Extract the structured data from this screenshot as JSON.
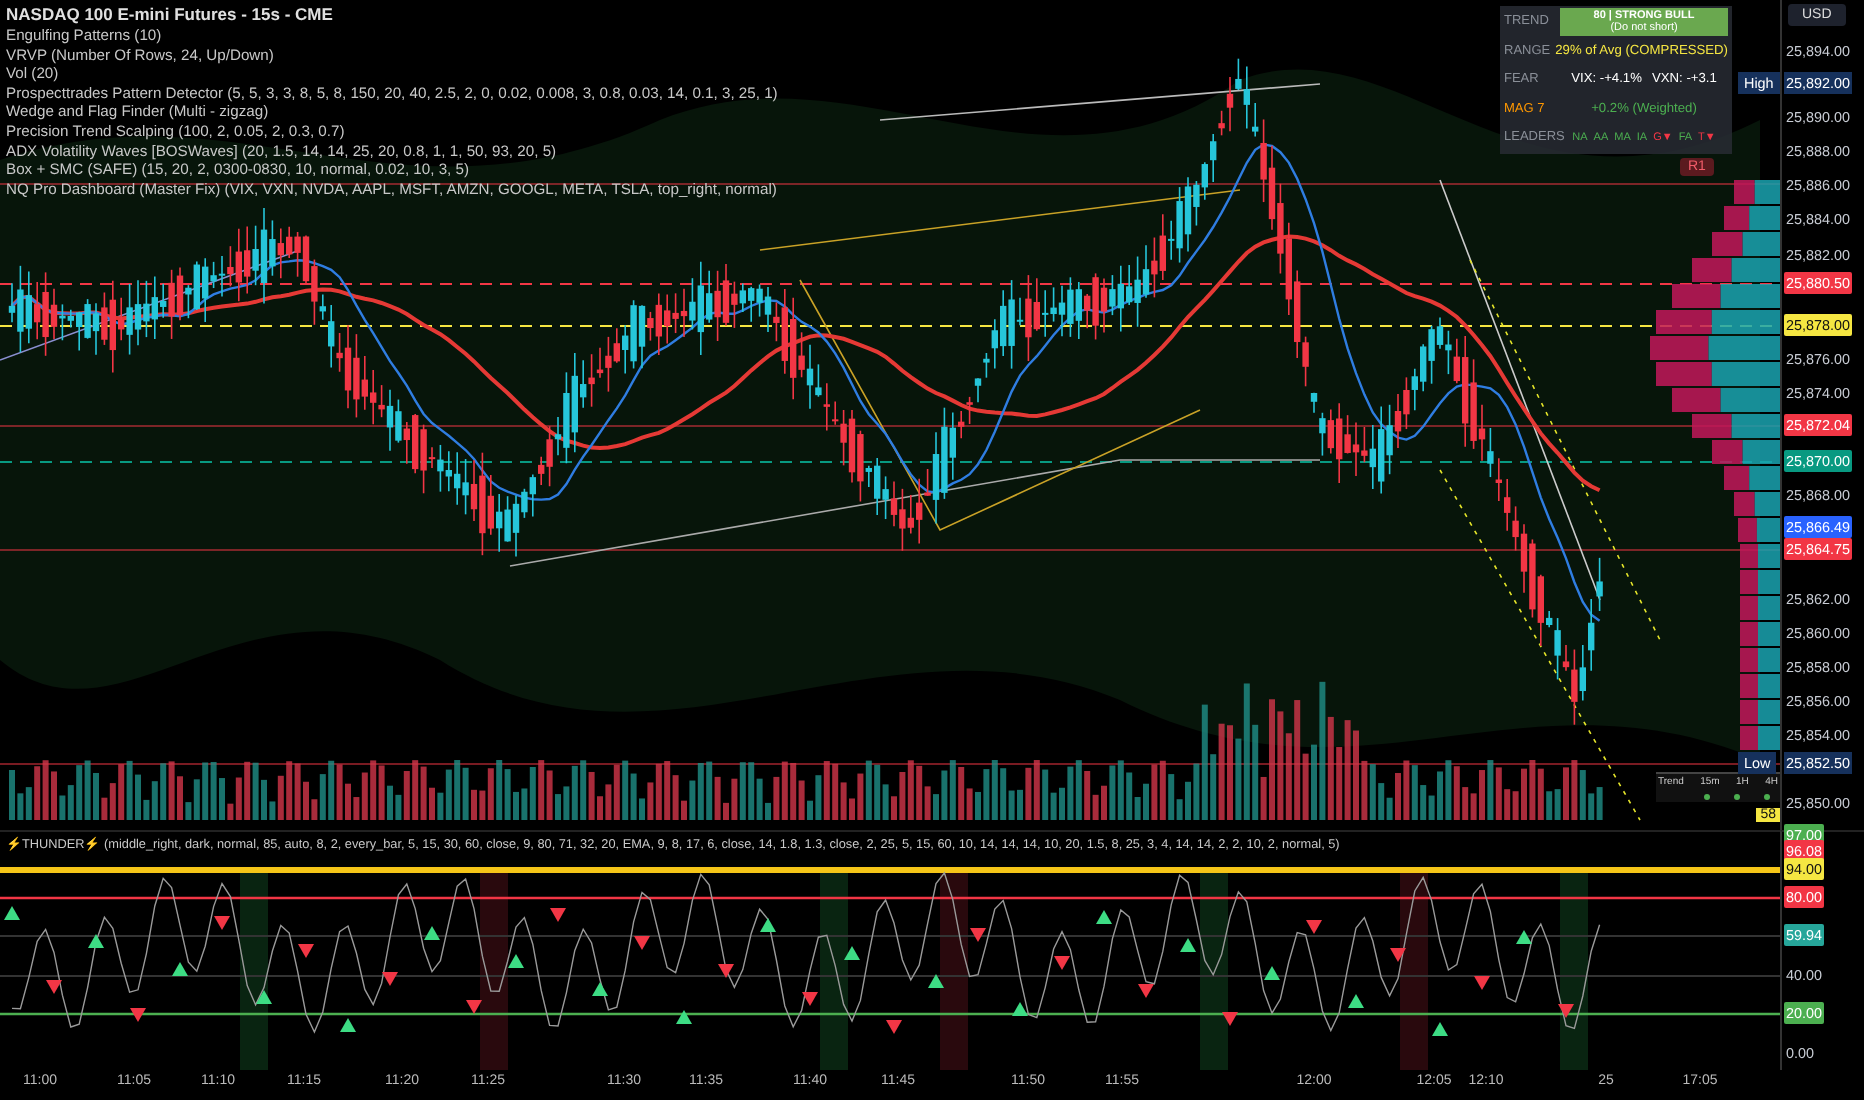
{
  "chart": {
    "title": "NASDAQ 100 E-mini Futures - 15s - CME",
    "indicators": [
      "Engulfing Patterns (10)",
      "VRVP (Number Of Rows, 24, Up/Down)",
      "Vol (20)",
      "Prospecttrades Pattern Detector (5, 5, 3, 3, 8, 5, 8, 150, 20, 40, 2.5, 2, 0, 0.02, 0.008, 3, 0.8, 0.03, 14, 0.1, 3, 25, 1)",
      "Wedge and Flag Finder (Multi - zigzag)",
      "Precision Trend Scalping (100, 2, 0.05, 2, 0.3, 0.7)",
      "ADX Volatility Waves [BOSWaves] (20, 1.5, 14, 14, 25, 20, 0.8, 1, 1, 50, 93, 20, 5)",
      "Box + SMC (SAFE) (15, 20, 2, 0300-0830, 10, normal, 0.02, 10, 3, 5)",
      "NQ Pro Dashboard (Master Fix) (VIX, VXN, NVDA, AAPL, MSFT, AMZN, GOOGL, META, TSLA, top_right, normal)"
    ],
    "r1_label": "R1"
  },
  "dashboard": {
    "rows": [
      {
        "label": "TREND",
        "highlighted": false,
        "kind": "banner",
        "value": "80 | STRONG BULL",
        "note": "(Do not short)"
      },
      {
        "label": "RANGE",
        "highlighted": false,
        "kind": "text",
        "value": "29% of Avg (COMPRESSED)",
        "color": "#f5e642"
      },
      {
        "label": "FEAR",
        "highlighted": false,
        "kind": "pair",
        "values": [
          "VIX: -+4.1%",
          "VXN: -+3.1"
        ]
      },
      {
        "label": "MAG 7",
        "highlighted": true,
        "kind": "text",
        "value": "+0.2% (Weighted)",
        "color": "#4caf50"
      },
      {
        "label": "LEADERS",
        "highlighted": false,
        "kind": "chips",
        "chips": [
          {
            "text": "NA",
            "color": "#4caf50"
          },
          {
            "text": "AA",
            "color": "#4caf50"
          },
          {
            "text": "MA",
            "color": "#4caf50"
          },
          {
            "text": "IA",
            "color": "#4caf50"
          },
          {
            "text": "G▼",
            "color": "#f23645"
          },
          {
            "text": "FA",
            "color": "#4caf50"
          },
          {
            "text": "T▼",
            "color": "#f23645"
          }
        ]
      }
    ]
  },
  "currency_button": "USD",
  "price_axis": [
    {
      "text": "25,894.00",
      "kind": "plain"
    },
    {
      "text": "25,892.00",
      "kind": "marker",
      "marker": "High"
    },
    {
      "text": "25,890.00",
      "kind": "plain"
    },
    {
      "text": "25,888.00",
      "kind": "plain"
    },
    {
      "text": "25,886.00",
      "kind": "plain"
    },
    {
      "text": "25,884.00",
      "kind": "plain"
    },
    {
      "text": "25,882.00",
      "kind": "plain"
    },
    {
      "text": "25,880.50",
      "kind": "tag",
      "color": "#f23645"
    },
    {
      "text": "25,878.00",
      "kind": "tag",
      "color": "#f5e642"
    },
    {
      "text": "25,876.00",
      "kind": "plain"
    },
    {
      "text": "25,874.00",
      "kind": "plain"
    },
    {
      "text": "25,872.04",
      "kind": "tag",
      "color": "#f23645"
    },
    {
      "text": "25,870.00",
      "kind": "tag",
      "color": "#089981"
    },
    {
      "text": "25,868.00",
      "kind": "plain"
    },
    {
      "text": "25,866.49",
      "kind": "tag",
      "color": "#2962ff"
    },
    {
      "text": "25,864.75",
      "kind": "tag",
      "color": "#f23645"
    },
    {
      "text": "25,862.00",
      "kind": "plain"
    },
    {
      "text": "25,860.00",
      "kind": "plain"
    },
    {
      "text": "25,858.00",
      "kind": "plain"
    },
    {
      "text": "25,856.00",
      "kind": "plain"
    },
    {
      "text": "25,854.00",
      "kind": "plain"
    },
    {
      "text": "25,852.50",
      "kind": "marker",
      "marker": "Low"
    },
    {
      "text": "25,850.00",
      "kind": "plain"
    }
  ],
  "timeframe_table": {
    "headers": [
      "Trend",
      "15m",
      "1H",
      "4H"
    ]
  },
  "oscillator": {
    "title": "⚡THUNDER⚡ (middle_right, dark, normal, 85, auto, 8, 2, every_bar, 5, 15, 30, 60, close, 9, 80, 71, 32, 20, EMA, 9, 8, 17, 6, close, 14, 1.8, 1.3, close, 2, 25, 5, 15, 60, 10, 14, 14, 14, 10, 20, 1.5, 8, 25, 3, 4, 14, 14, 2, 2, 10, 2, normal, 5)",
    "value_tag": {
      "text": "58",
      "color": "#f5e642"
    },
    "axis": [
      {
        "text": "97.00",
        "kind": "tag",
        "color": "#4caf50"
      },
      {
        "text": "96.08",
        "kind": "tag",
        "color": "#f23645"
      },
      {
        "text": "94.00",
        "kind": "tag",
        "color": "#f5e642"
      },
      {
        "text": "80.00",
        "kind": "tag",
        "color": "#f23645"
      },
      {
        "text": "59.94",
        "kind": "tag",
        "color": "#26a69a"
      },
      {
        "text": "40.00",
        "kind": "plain"
      },
      {
        "text": "20.00",
        "kind": "tag",
        "color": "#4caf50"
      },
      {
        "text": "0.00",
        "kind": "plain"
      }
    ]
  },
  "time_axis": [
    "11:00",
    "11:05",
    "11:10",
    "11:15",
    "11:20",
    "11:25",
    "11:30",
    "11:35",
    "11:40",
    "11:45",
    "11:50",
    "11:55",
    "12:00",
    "12:05",
    "12:10",
    "25",
    "17:05"
  ]
}
